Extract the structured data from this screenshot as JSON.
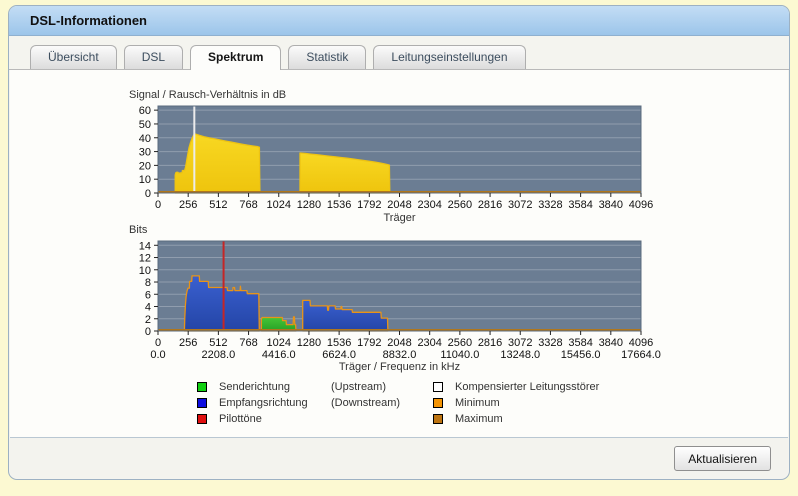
{
  "header": {
    "title": "DSL-Informationen"
  },
  "tabs": [
    {
      "label": "Übersicht"
    },
    {
      "label": "DSL"
    },
    {
      "label": "Spektrum"
    },
    {
      "label": "Statistik"
    },
    {
      "label": "Leitungseinstellungen"
    }
  ],
  "active_tab": "Spektrum",
  "footer": {
    "button_label": "Aktualisieren"
  },
  "legend": {
    "rows": [
      {
        "label": "Senderichtung",
        "sub": "(Upstream)",
        "color": "#10d010",
        "label2": "Kompensierter Leitungsstörer",
        "color2": "#ffffff"
      },
      {
        "label": "Empfangsrichtung",
        "sub": "(Downstream)",
        "color": "#0d0de0",
        "label2": "Minimum",
        "color2": "#f49404"
      },
      {
        "label": "Pilottöne",
        "sub": "",
        "color": "#e01010",
        "label2": "Maximum",
        "color2": "#bd7411"
      }
    ]
  },
  "chart_data": [
    {
      "type": "area",
      "title": "Signal / Rausch-Verhältnis in dB",
      "xlabel": "Träger",
      "xlim": [
        0,
        4096
      ],
      "xticks": [
        0,
        256,
        512,
        768,
        1024,
        1280,
        1536,
        1792,
        2048,
        2304,
        2560,
        2816,
        3072,
        3328,
        3584,
        3840,
        4096
      ],
      "ylim": [
        0,
        63
      ],
      "yticks": [
        0,
        10,
        20,
        30,
        40,
        50,
        60
      ],
      "grid": true,
      "plot_bg": "#6b7d93",
      "grid_color": "rgba(255,255,255,0.25)",
      "baseline_color": "#b0761b",
      "series": [
        {
          "name": "snr",
          "fill": "#f8d822",
          "fill2": "#eec40d",
          "stroke": "#edc313",
          "segments": [
            [
              [
                146,
                0
              ],
              [
                146,
                13
              ],
              [
                150,
                14.5
              ],
              [
                156,
                15
              ],
              [
                170,
                15
              ],
              [
                174,
                14.3
              ],
              [
                204,
                14.8
              ],
              [
                207,
                16.3
              ],
              [
                226,
                16.3
              ],
              [
                234,
                19
              ],
              [
                244,
                24
              ],
              [
                254,
                29
              ],
              [
                264,
                33
              ],
              [
                276,
                36.5
              ],
              [
                288,
                39.5
              ],
              [
                300,
                41.5
              ],
              [
                309,
                43
              ],
              [
                322,
                42.5
              ],
              [
                352,
                41.7
              ],
              [
                392,
                40.8
              ],
              [
                432,
                40
              ],
              [
                480,
                39.2
              ],
              [
                528,
                38.4
              ],
              [
                576,
                37.6
              ],
              [
                624,
                36.8
              ],
              [
                672,
                36
              ],
              [
                716,
                35.3
              ],
              [
                760,
                34.6
              ],
              [
                806,
                34
              ],
              [
                846,
                33.5
              ],
              [
                860,
                33.2
              ],
              [
                864,
                0
              ]
            ],
            [
              [
                1204,
                0
              ],
              [
                1204,
                29
              ],
              [
                1248,
                28.7
              ],
              [
                1296,
                28.2
              ],
              [
                1344,
                27.7
              ],
              [
                1396,
                27.2
              ],
              [
                1448,
                26.7
              ],
              [
                1500,
                26.2
              ],
              [
                1552,
                25.7
              ],
              [
                1604,
                25.2
              ],
              [
                1656,
                24.6
              ],
              [
                1708,
                24
              ],
              [
                1756,
                23.4
              ],
              [
                1800,
                22.9
              ],
              [
                1844,
                22.3
              ],
              [
                1884,
                21.7
              ],
              [
                1920,
                21.1
              ],
              [
                1948,
                20.6
              ],
              [
                1962,
                20.2
              ],
              [
                1966,
                0
              ]
            ]
          ]
        }
      ],
      "markers": [
        {
          "name": "kompensierter-leitungsstoerer",
          "x": 308,
          "color": "#ececec"
        }
      ]
    },
    {
      "type": "area",
      "title": "Bits",
      "xlabel": "Träger / Frequenz in kHz",
      "xlim": [
        0,
        4096
      ],
      "xticks": [
        0,
        256,
        512,
        768,
        1024,
        1280,
        1536,
        1792,
        2048,
        2304,
        2560,
        2816,
        3072,
        3328,
        3584,
        3840,
        4096
      ],
      "xticks2": [
        [
          0,
          "0.0"
        ],
        [
          512,
          "2208.0"
        ],
        [
          1024,
          "4416.0"
        ],
        [
          1536,
          "6624.0"
        ],
        [
          2048,
          "8832.0"
        ],
        [
          2560,
          "11040.0"
        ],
        [
          3072,
          "13248.0"
        ],
        [
          3584,
          "15456.0"
        ],
        [
          4096,
          "17664.0"
        ]
      ],
      "ylim": [
        0,
        14.7
      ],
      "yticks": [
        0,
        2,
        4,
        6,
        8,
        10,
        12,
        14
      ],
      "grid": true,
      "plot_bg": "#6b7d93",
      "grid_color": "rgba(255,255,255,0.25)",
      "baseline_color": "#b0761b",
      "series": [
        {
          "name": "downstream",
          "fill": "#3a60d0",
          "fill2": "#2445a6",
          "stroke": "#e89418",
          "segments": [
            [
              [
                224,
                0
              ],
              [
                227,
                2.2
              ],
              [
                232,
                4.2
              ],
              [
                238,
                5.6
              ],
              [
                246,
                6.5
              ],
              [
                254,
                7
              ],
              [
                266,
                7
              ],
              [
                268,
                8.1
              ],
              [
                286,
                8.1
              ],
              [
                288,
                9
              ],
              [
                350,
                9
              ],
              [
                353,
                8.1
              ],
              [
                426,
                8.1
              ],
              [
                429,
                7.1
              ],
              [
                586,
                7.1
              ],
              [
                589,
                6.6
              ],
              [
                634,
                6.6
              ],
              [
                637,
                7.1
              ],
              [
                649,
                7.1
              ],
              [
                652,
                6.6
              ],
              [
                696,
                6.6
              ],
              [
                699,
                7.3
              ],
              [
                703,
                6.6
              ],
              [
                754,
                6.6
              ],
              [
                757,
                6.1
              ],
              [
                855,
                6.1
              ],
              [
                859,
                0
              ]
            ],
            [
              [
                1227,
                0
              ],
              [
                1227,
                5
              ],
              [
                1289,
                5
              ],
              [
                1292,
                4.1
              ],
              [
                1436,
                4.1
              ],
              [
                1439,
                3.4
              ],
              [
                1446,
                3.4
              ],
              [
                1449,
                4.1
              ],
              [
                1502,
                4.1
              ],
              [
                1505,
                3.6
              ],
              [
                1550,
                3.6
              ],
              [
                1553,
                4
              ],
              [
                1558,
                4
              ],
              [
                1561,
                3.5
              ],
              [
                1646,
                3.5
              ],
              [
                1649,
                3.05
              ],
              [
                1890,
                3.05
              ],
              [
                1894,
                2.1
              ],
              [
                1946,
                2.1
              ],
              [
                1950,
                0
              ]
            ]
          ]
        },
        {
          "name": "upstream",
          "fill": "#46c637",
          "fill2": "#27a127",
          "stroke": "#e89418",
          "segments": [
            [
              [
                877,
                0
              ],
              [
                877,
                2
              ],
              [
                884,
                2.2
              ],
              [
                1054,
                2.2
              ],
              [
                1057,
                1.7
              ],
              [
                1086,
                1.7
              ],
              [
                1089,
                1.05
              ],
              [
                1146,
                1.05
              ],
              [
                1149,
                2.3
              ],
              [
                1157,
                2.3
              ],
              [
                1160,
                1.05
              ],
              [
                1167,
                1.05
              ],
              [
                1170,
                0
              ]
            ]
          ]
        }
      ],
      "markers": [
        {
          "name": "pilotton",
          "x": 556,
          "color": "#c52626"
        }
      ]
    }
  ]
}
